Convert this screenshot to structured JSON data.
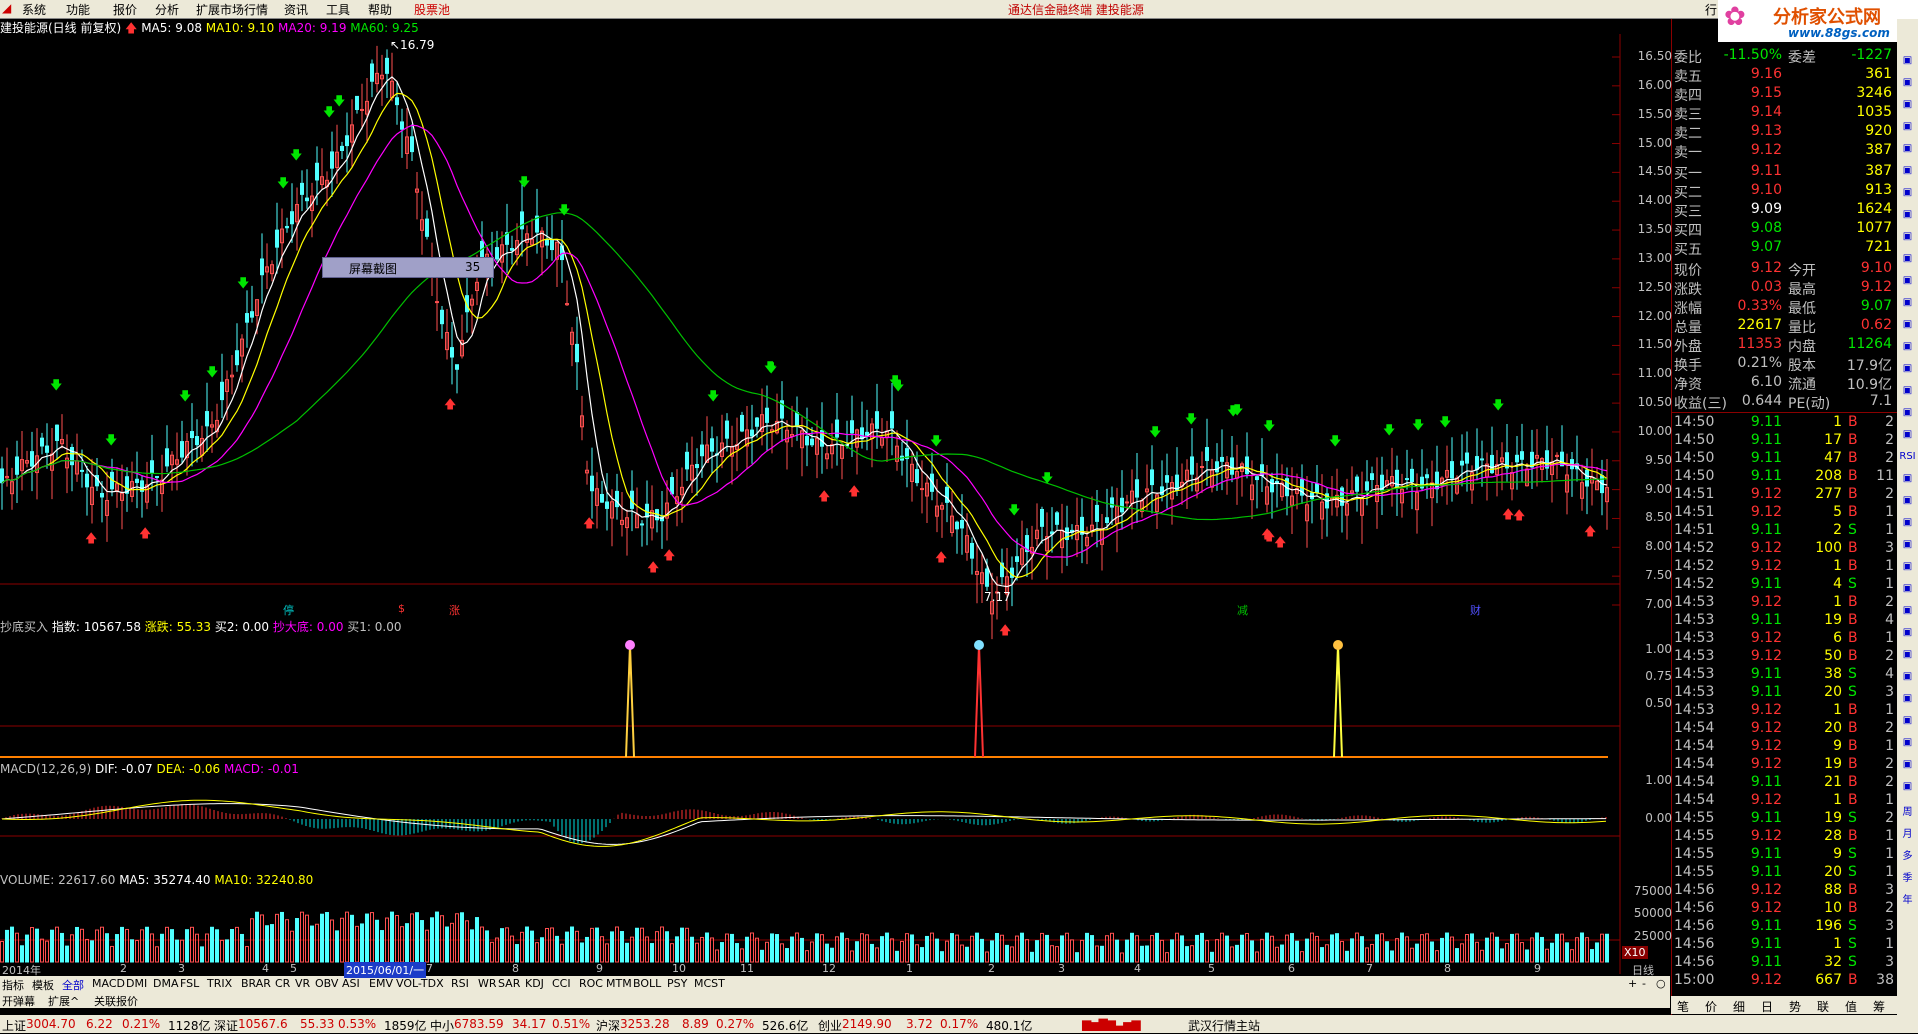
{
  "menu": {
    "items": [
      "系统",
      "功能",
      "报价",
      "分析",
      "扩展市场行情",
      "资讯",
      "工具",
      "帮助"
    ],
    "stock_pool": "股票池",
    "center_title": "通达信金融终端    建投能源",
    "right_label": "行",
    "logo_title": "分析家公式网",
    "logo_url": "www.88gs.com"
  },
  "price_pane": {
    "stock_name": "建投能源(日线 前复权)",
    "ma5": "MA5: 9.08",
    "ma10": "MA10: 9.10",
    "ma20": "MA20: 9.19",
    "ma60": "MA60: 9.25",
    "high_mark": "16.79",
    "low_mark": "7.17",
    "popup_text": "屏幕截图",
    "popup_num": "35",
    "y_ticks": [
      "16.50",
      "16.00",
      "15.50",
      "15.00",
      "14.50",
      "14.00",
      "13.50",
      "13.00",
      "12.50",
      "12.00",
      "11.50",
      "11.00",
      "10.50",
      "10.00",
      "9.50",
      "9.00",
      "8.50",
      "8.00",
      "7.50",
      "7.00"
    ],
    "event_marks": [
      "停",
      "$",
      "涨",
      "减",
      "财"
    ]
  },
  "ind1": {
    "title": "抄底买入",
    "index": "指数: 10567.58",
    "zd": "涨跌: 55.33",
    "buy2": "买2: 0.00",
    "cdd": "抄大底: 0.00",
    "buy1": "买1: 0.00",
    "y_ticks": [
      "1.00",
      "0.75",
      "0.50"
    ]
  },
  "macd": {
    "title": "MACD(12,26,9)",
    "dif": "DIF: -0.07",
    "dea": "DEA: -0.06",
    "macd": "MACD: -0.01",
    "y_ticks": [
      "1.00",
      "0.00"
    ]
  },
  "volume": {
    "title": "VOLUME: 22617.60",
    "ma5": "MA5: 35274.40",
    "ma10": "MA10: 32240.80",
    "y_ticks": [
      "75000",
      "50000",
      "25000"
    ],
    "unit": "X10"
  },
  "date_axis": {
    "labels": [
      "2014年",
      "2",
      "3",
      "4",
      "5",
      "7",
      "8",
      "9",
      "10",
      "11",
      "12",
      "1",
      "2",
      "3",
      "4",
      "5",
      "6",
      "7",
      "8",
      "9"
    ],
    "cursor_date": "2015/06/01/一",
    "period": "日线"
  },
  "tabs": [
    "指标",
    "模板",
    "全部",
    "MACD",
    "DMI",
    "DMA",
    "FSL",
    "TRIX",
    "BRAR",
    "CR",
    "VR",
    "OBV",
    "ASI",
    "EMV",
    "VOL-TDX",
    "RSI",
    "WR",
    "SAR",
    "KDJ",
    "CCI",
    "ROC",
    "MTM",
    "BOLL",
    "PSY",
    "MCST"
  ],
  "tabs2": [
    "开弹幕",
    "扩展^",
    "关联报价"
  ],
  "zoom_controls": [
    "+",
    "-",
    "○"
  ],
  "quote": {
    "weibi_label": "委比",
    "weibi": "-11.50%",
    "weicha_label": "委差",
    "weicha": "-1227",
    "sell": [
      {
        "label": "卖五",
        "price": "9.16",
        "vol": "361"
      },
      {
        "label": "卖四",
        "price": "9.15",
        "vol": "3246"
      },
      {
        "label": "卖三",
        "price": "9.14",
        "vol": "1035"
      },
      {
        "label": "卖二",
        "price": "9.13",
        "vol": "920"
      },
      {
        "label": "卖一",
        "price": "9.12",
        "vol": "387"
      }
    ],
    "buy": [
      {
        "label": "买一",
        "price": "9.11",
        "vol": "387"
      },
      {
        "label": "买二",
        "price": "9.10",
        "vol": "913"
      },
      {
        "label": "买三",
        "price": "9.09",
        "vol": "1624"
      },
      {
        "label": "买四",
        "price": "9.08",
        "vol": "1077"
      },
      {
        "label": "买五",
        "price": "9.07",
        "vol": "721"
      }
    ],
    "stats": [
      {
        "l1": "现价",
        "v1": "9.12",
        "l2": "今开",
        "v2": "9.10"
      },
      {
        "l1": "涨跌",
        "v1": "0.03",
        "l2": "最高",
        "v2": "9.12"
      },
      {
        "l1": "涨幅",
        "v1": "0.33%",
        "l2": "最低",
        "v2": "9.07"
      },
      {
        "l1": "总量",
        "v1": "22617",
        "l2": "量比",
        "v2": "0.62"
      },
      {
        "l1": "外盘",
        "v1": "11353",
        "l2": "内盘",
        "v2": "11264"
      },
      {
        "l1": "换手",
        "v1": "0.21%",
        "l2": "股本",
        "v2": "17.9亿"
      },
      {
        "l1": "净资",
        "v1": "6.10",
        "l2": "流通",
        "v2": "10.9亿"
      },
      {
        "l1": "收益(三)",
        "v1": "0.644",
        "l2": "PE(动)",
        "v2": "7.1"
      }
    ],
    "ticks": [
      [
        "14:50",
        "9.11",
        "1",
        "B",
        "2"
      ],
      [
        "14:50",
        "9.11",
        "17",
        "B",
        "2"
      ],
      [
        "14:50",
        "9.11",
        "47",
        "B",
        "2"
      ],
      [
        "14:50",
        "9.11",
        "208",
        "B",
        "11"
      ],
      [
        "14:51",
        "9.12",
        "277",
        "B",
        "2"
      ],
      [
        "14:51",
        "9.12",
        "5",
        "B",
        "1"
      ],
      [
        "14:51",
        "9.11",
        "2",
        "S",
        "1"
      ],
      [
        "14:52",
        "9.12",
        "100",
        "B",
        "3"
      ],
      [
        "14:52",
        "9.12",
        "1",
        "B",
        "1"
      ],
      [
        "14:52",
        "9.11",
        "4",
        "S",
        "1"
      ],
      [
        "14:53",
        "9.12",
        "1",
        "B",
        "2"
      ],
      [
        "14:53",
        "9.11",
        "19",
        "B",
        "4"
      ],
      [
        "14:53",
        "9.12",
        "6",
        "B",
        "1"
      ],
      [
        "14:53",
        "9.12",
        "50",
        "B",
        "2"
      ],
      [
        "14:53",
        "9.11",
        "38",
        "S",
        "4"
      ],
      [
        "14:53",
        "9.11",
        "20",
        "S",
        "3"
      ],
      [
        "14:53",
        "9.12",
        "1",
        "B",
        "1"
      ],
      [
        "14:54",
        "9.12",
        "20",
        "B",
        "2"
      ],
      [
        "14:54",
        "9.12",
        "9",
        "B",
        "1"
      ],
      [
        "14:54",
        "9.12",
        "19",
        "B",
        "2"
      ],
      [
        "14:54",
        "9.11",
        "21",
        "B",
        "2"
      ],
      [
        "14:54",
        "9.12",
        "1",
        "B",
        "1"
      ],
      [
        "14:55",
        "9.11",
        "19",
        "S",
        "2"
      ],
      [
        "14:55",
        "9.12",
        "28",
        "B",
        "1"
      ],
      [
        "14:55",
        "9.11",
        "9",
        "S",
        "1"
      ],
      [
        "14:55",
        "9.11",
        "20",
        "S",
        "1"
      ],
      [
        "14:56",
        "9.12",
        "88",
        "B",
        "3"
      ],
      [
        "14:56",
        "9.12",
        "10",
        "B",
        "2"
      ],
      [
        "14:56",
        "9.11",
        "196",
        "S",
        "3"
      ],
      [
        "14:56",
        "9.11",
        "1",
        "S",
        "1"
      ],
      [
        "14:56",
        "9.11",
        "32",
        "S",
        "3"
      ],
      [
        "15:00",
        "9.12",
        "667",
        "B",
        "38"
      ]
    ]
  },
  "rp_tabs": [
    "笔",
    "价",
    "细",
    "日",
    "势",
    "联",
    "值",
    "筹"
  ],
  "right_toolbar": [
    "",
    "",
    "",
    "",
    "",
    "",
    "",
    "",
    "",
    "",
    "",
    "",
    "",
    "",
    "",
    "",
    "",
    "",
    "RSI",
    "",
    "",
    "",
    "",
    "",
    "",
    "",
    "",
    "",
    "",
    "",
    "",
    "",
    "",
    "",
    "周",
    "月",
    "多",
    "季",
    "年"
  ],
  "status": {
    "sh_label": "上证",
    "sh": "3004.70",
    "sh_chg": "6.22",
    "sh_pct": "0.21%",
    "sh_amt": "1128亿",
    "sz_label": "深证",
    "sz": "10567.6",
    "sz_chg": "55.33",
    "sz_pct": "0.53%",
    "sz_amt": "1859亿",
    "zx_label": "中小",
    "zx": "6783.59",
    "zx_chg": "34.17",
    "zx_pct": "0.51%",
    "hs_label": "沪深",
    "hs": "3253.28",
    "hs_chg": "8.89",
    "hs_pct": "0.27%",
    "hs_amt": "526.6亿",
    "cy_label": "创业",
    "cy": "2149.90",
    "cy_chg": "3.72",
    "cy_pct": "0.17%",
    "cy_amt": "480.1亿",
    "server": "武汉行情主站"
  },
  "colors": {
    "up": "#ff3232",
    "down": "#00e600",
    "bg": "#000000",
    "border": "#8b0000",
    "ma5": "#ffffff",
    "ma10": "#ffff00",
    "ma20": "#ff00ff",
    "ma60": "#00c000"
  }
}
